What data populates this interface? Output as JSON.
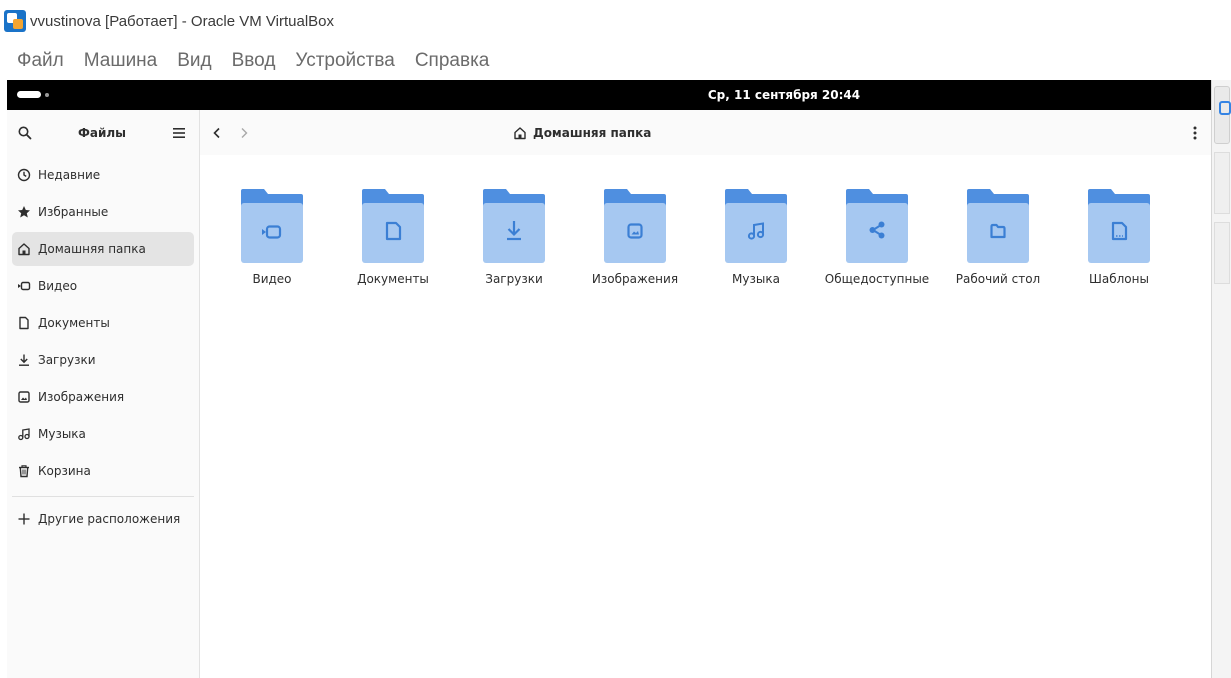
{
  "window": {
    "title": "vvustinova [Работает] - Oracle VM VirtualBox",
    "menu": [
      "Файл",
      "Машина",
      "Вид",
      "Ввод",
      "Устройства",
      "Справка"
    ]
  },
  "topbar": {
    "clock": "Ср, 11 сентября  20:44"
  },
  "files": {
    "sidebar_title": "Файлы",
    "location": "Домашняя папка",
    "places": [
      {
        "label": "Недавние",
        "icon": "clock-icon"
      },
      {
        "label": "Избранные",
        "icon": "star-icon"
      },
      {
        "label": "Домашняя папка",
        "icon": "home-icon",
        "active": true
      },
      {
        "label": "Видео",
        "icon": "video-icon"
      },
      {
        "label": "Документы",
        "icon": "document-icon"
      },
      {
        "label": "Загрузки",
        "icon": "download-icon"
      },
      {
        "label": "Изображения",
        "icon": "image-icon"
      },
      {
        "label": "Музыка",
        "icon": "music-icon"
      },
      {
        "label": "Корзина",
        "icon": "trash-icon"
      }
    ],
    "other_locations": "Другие расположения",
    "folders": [
      {
        "label": "Видео",
        "icon": "video-icon"
      },
      {
        "label": "Документы",
        "icon": "document-icon"
      },
      {
        "label": "Загрузки",
        "icon": "download-icon"
      },
      {
        "label": "Изображения",
        "icon": "image-icon"
      },
      {
        "label": "Музыка",
        "icon": "music-icon"
      },
      {
        "label": "Общедоступные",
        "icon": "share-icon"
      },
      {
        "label": "Рабочий стол",
        "icon": "desktop-icon"
      },
      {
        "label": "Шаблоны",
        "icon": "template-icon"
      }
    ]
  },
  "colors": {
    "folder_back": "#4f8fe0",
    "folder_front": "#a6c8f1",
    "folder_glyph": "#3b7fd4",
    "topbar": "#000000"
  }
}
